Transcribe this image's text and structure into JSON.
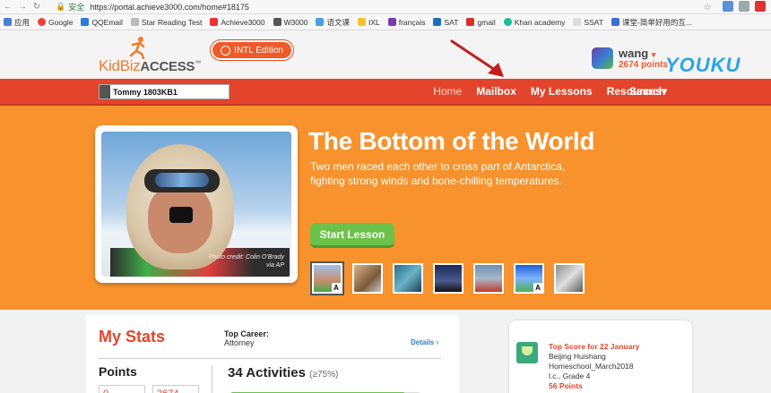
{
  "browser": {
    "secure_label": "安全",
    "url": "https://portal.achieve3000.com/home#18175",
    "bookmarks": [
      "应用",
      "Google",
      "QQEmail",
      "Star Reading Test",
      "Achieve3000",
      "W3000",
      "语文课",
      "IXL",
      "français",
      "SAT",
      "gmail",
      "Khan academy",
      "SSAT",
      "课堂-简单好用的互..."
    ]
  },
  "header": {
    "logo_kid": "KidBiz",
    "logo_access": "ACCESS",
    "logo_tm": "™",
    "intl_label": "INTL Edition",
    "user_name": "wang",
    "user_points": "2674 points",
    "watermark": "YOUKU"
  },
  "nav": {
    "class_value": "Tommy 1803KB1",
    "home": "Home",
    "mailbox": "Mailbox",
    "my_lessons": "My Lessons",
    "resources": "Resources",
    "resources_caret": "▾",
    "search": "Search"
  },
  "hero": {
    "title": "The Bottom of the World",
    "description": "Two men raced each other to cross part of Antarctica, fighting strong winds and bone-chilling temperatures.",
    "photo_credit_1": "Photo credit: Colin O'Brady",
    "photo_credit_2": "via AP",
    "start_label": "Start Lesson",
    "thumb_tag": "A"
  },
  "stats": {
    "title": "My Stats",
    "top_career_label": "Top Career:",
    "top_career_value": "Attorney",
    "details_label": "Details",
    "points_label": "Points",
    "points_box_1": "0",
    "points_box_2": "2674",
    "activities_label": "34 Activities",
    "activities_pct": "(≥75%)",
    "progress_fraction": 0.92
  },
  "score": {
    "title": "Top Score for 22 January",
    "school": "Beijing Huishang",
    "class": "Homeschool_March2018",
    "level": "l.c., Grade 4",
    "points": "56 Points"
  },
  "colors": {
    "nav_red": "#e2452c",
    "hero_orange": "#f7922d",
    "start_green": "#6cc24a",
    "link_blue": "#2c7fd1"
  }
}
